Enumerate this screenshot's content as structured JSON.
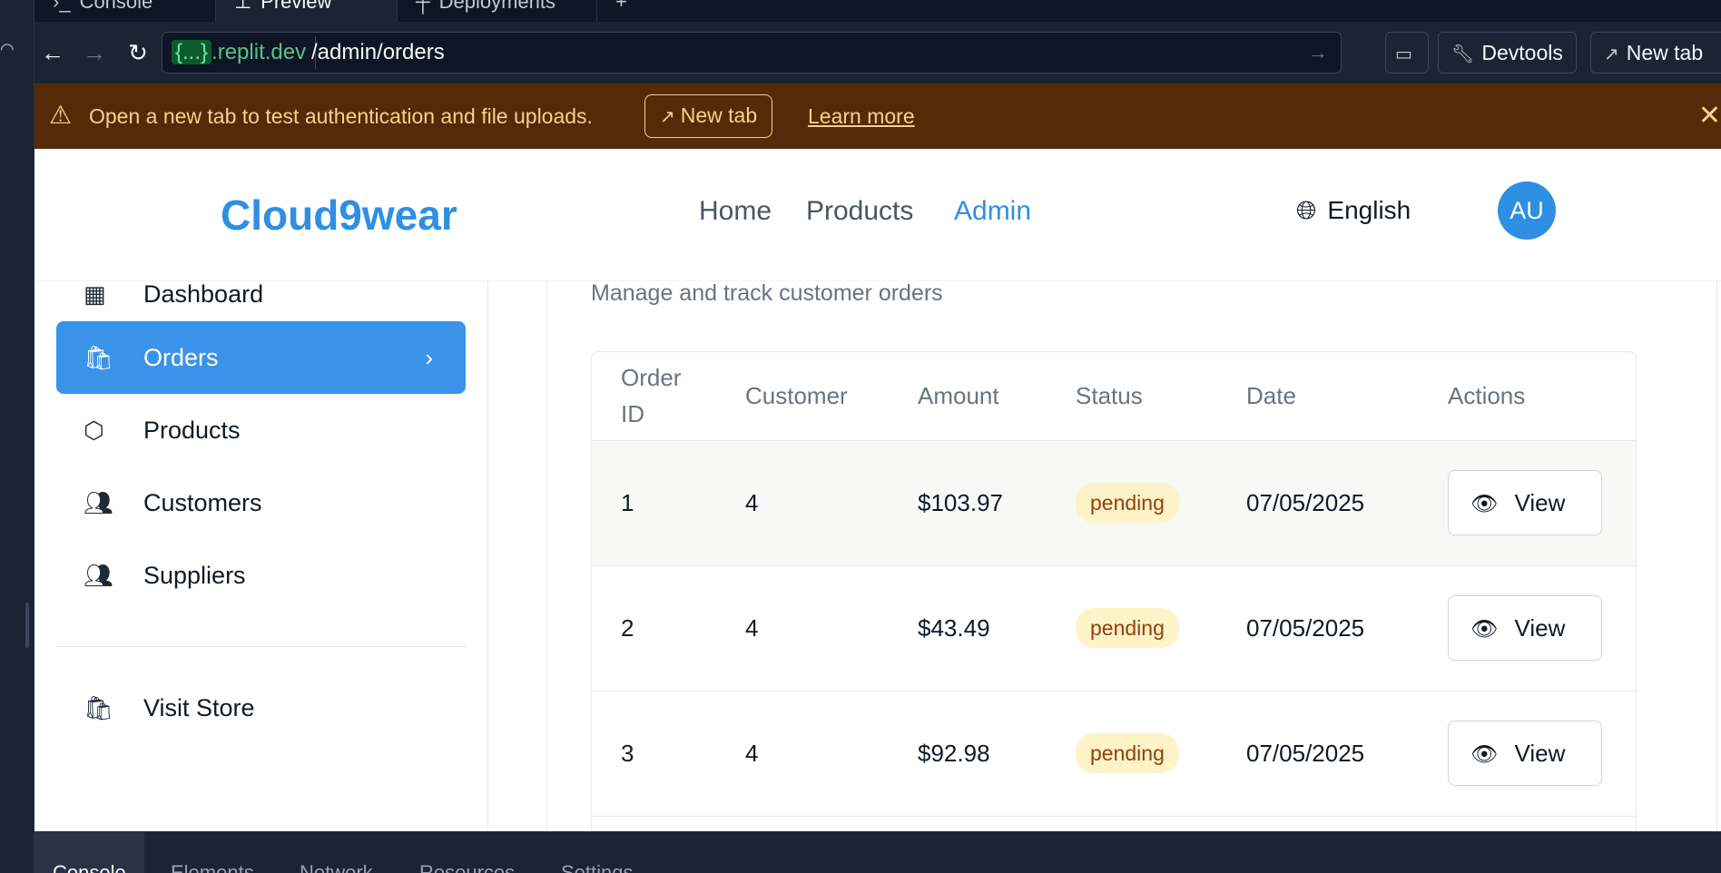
{
  "browser": {
    "tabs": [
      {
        "label": "Console"
      },
      {
        "label": "Preview"
      },
      {
        "label": "Deployments"
      }
    ],
    "domain_brace": "{...}",
    "domain_suffix": ".replit.dev",
    "path": "/admin/orders",
    "devtools_label": "Devtools",
    "new_tab_label": "New tab"
  },
  "banner": {
    "message": "Open a new tab to test authentication and file uploads.",
    "button_label": "New tab",
    "link_label": "Learn more"
  },
  "header": {
    "logo": "Cloud9wear",
    "nav": [
      {
        "label": "Home"
      },
      {
        "label": "Products"
      },
      {
        "label": "Admin"
      }
    ],
    "language": "English",
    "avatar_initials": "AU"
  },
  "sidebar": {
    "items": [
      {
        "label": "Dashboard",
        "icon": "dashboard-icon"
      },
      {
        "label": "Orders",
        "icon": "shopping-bag-icon"
      },
      {
        "label": "Products",
        "icon": "package-icon"
      },
      {
        "label": "Customers",
        "icon": "users-icon"
      },
      {
        "label": "Suppliers",
        "icon": "users-icon"
      }
    ],
    "visit_store": "Visit Store"
  },
  "main": {
    "subtitle": "Manage and track customer orders",
    "columns": [
      "Order ID",
      "Customer",
      "Amount",
      "Status",
      "Date",
      "Actions"
    ],
    "rows": [
      {
        "id": "1",
        "customer": "4",
        "amount": "$103.97",
        "status": "pending",
        "date": "07/05/2025",
        "action": "View"
      },
      {
        "id": "2",
        "customer": "4",
        "amount": "$43.49",
        "status": "pending",
        "date": "07/05/2025",
        "action": "View"
      },
      {
        "id": "3",
        "customer": "4",
        "amount": "$92.98",
        "status": "pending",
        "date": "07/05/2025",
        "action": "View"
      }
    ]
  },
  "devtools": {
    "tabs": [
      "Console",
      "Elements",
      "Network",
      "Resources",
      "Settings"
    ]
  },
  "colors": {
    "accent": "#2f8fe3",
    "banner_bg": "#552a08",
    "banner_text": "#f9d08b",
    "badge_bg": "#fef3c7",
    "badge_text": "#92400e"
  }
}
